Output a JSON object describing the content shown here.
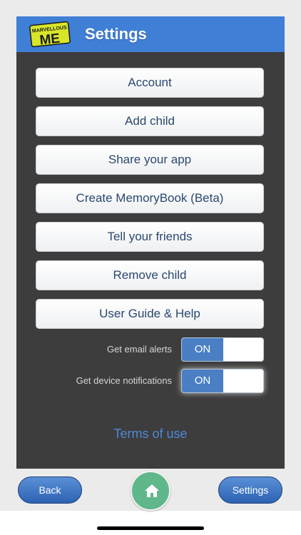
{
  "header": {
    "logo_text": "MARVELLOUS ME",
    "title": "Settings"
  },
  "menu": [
    {
      "label": "Account"
    },
    {
      "label": "Add child"
    },
    {
      "label": "Share your app"
    },
    {
      "label": "Create MemoryBook (Beta)"
    },
    {
      "label": "Tell your friends"
    },
    {
      "label": "Remove child"
    },
    {
      "label": "User Guide & Help"
    }
  ],
  "toggles": {
    "email_alerts": {
      "label": "Get email alerts",
      "state": "ON"
    },
    "device_notifications": {
      "label": "Get device notifications",
      "state": "ON"
    }
  },
  "terms_link": "Terms of use",
  "bottom_nav": {
    "back_label": "Back",
    "settings_label": "Settings"
  },
  "colors": {
    "header_blue": "#3f7fd6",
    "panel_dark": "#3d3d3d",
    "toggle_on": "#4a7fc3",
    "home_green": "#5fb78a",
    "link_blue": "#4f88d8"
  },
  "icons": {
    "home": "home-icon",
    "logo": "marvellous-me-logo"
  }
}
